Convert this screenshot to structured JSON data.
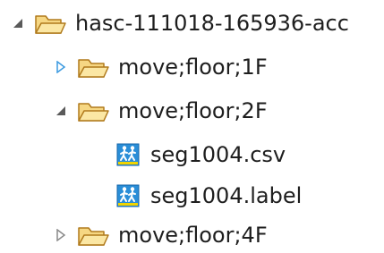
{
  "tree": {
    "root": {
      "label": "hasc-111018-165936-acc",
      "expanded": true,
      "icon": "folder-open-icon",
      "children": [
        {
          "label": "move;floor;1F",
          "expanded": false,
          "icon": "folder-closed-icon",
          "twisty_color": "#3c9ae0"
        },
        {
          "label": "move;floor;2F",
          "expanded": true,
          "icon": "folder-open-icon",
          "children": [
            {
              "label": "seg1004.csv",
              "icon": "walking-person-file-icon"
            },
            {
              "label": "seg1004.label",
              "icon": "walking-person-file-icon"
            }
          ]
        },
        {
          "label": "move;floor;4F",
          "expanded": false,
          "icon": "folder-closed-icon",
          "twisty_color": "#8a8a8a"
        }
      ]
    }
  },
  "colors": {
    "folder_fill": "#f6d783",
    "folder_stroke": "#b07a1c",
    "file_icon_blue": "#2a8ed8",
    "text": "#1e1e1e"
  }
}
